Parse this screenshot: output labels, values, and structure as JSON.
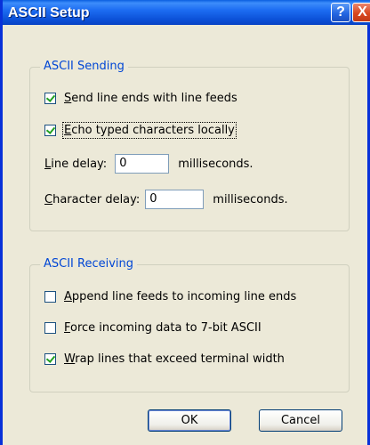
{
  "window": {
    "title": "ASCII Setup",
    "help_glyph": "?",
    "close_glyph": "X"
  },
  "sending": {
    "legend": "ASCII Sending",
    "send_line_ends": {
      "accel": "S",
      "rest": "end line ends with line feeds",
      "checked": true
    },
    "echo_typed": {
      "accel": "E",
      "rest": "cho typed characters locally",
      "checked": true
    },
    "line_delay": {
      "accel": "L",
      "rest": "ine delay:",
      "value": "0",
      "units": "milliseconds."
    },
    "char_delay": {
      "accel": "C",
      "rest": "haracter delay:",
      "value": "0",
      "units": "milliseconds."
    }
  },
  "receiving": {
    "legend": "ASCII Receiving",
    "append_line_feeds": {
      "accel": "A",
      "rest": "ppend line feeds to incoming line ends",
      "checked": false
    },
    "force_7bit": {
      "accel": "F",
      "rest": "orce incoming data to 7-bit ASCII",
      "checked": false
    },
    "wrap_lines": {
      "accel": "W",
      "rest": "rap lines that exceed terminal width",
      "checked": true
    }
  },
  "buttons": {
    "ok": "OK",
    "cancel": "Cancel"
  }
}
